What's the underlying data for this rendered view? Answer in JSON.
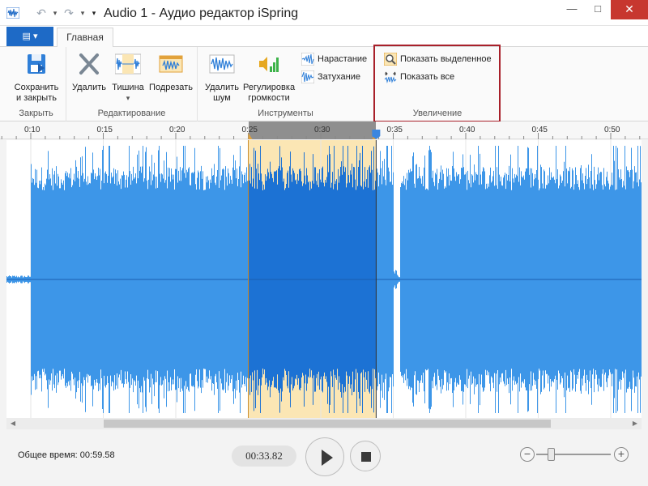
{
  "window": {
    "title": "Audio 1 - Аудио редактор iSpring",
    "minimize": "—",
    "maximize": "□",
    "close": "✕"
  },
  "quick_access": {
    "undo": "↶",
    "redo": "↷",
    "dropdown": "▾"
  },
  "ribbon": {
    "file_button": "▤ ▾",
    "tab_home": "Главная",
    "groups": {
      "close": {
        "label": "Закрыть",
        "save_close_line1": "Сохранить",
        "save_close_line2": "и закрыть"
      },
      "edit": {
        "label": "Редактирование",
        "delete": "Удалить",
        "silence": "Тишина",
        "silence_arrow": "▾",
        "trim": "Подрезать"
      },
      "tools": {
        "label": "Инструменты",
        "noise_line1": "Удалить",
        "noise_line2": "шум",
        "volume_line1": "Регулировка",
        "volume_line2": "громкости",
        "fade_in": "Нарастание",
        "fade_out": "Затухание"
      },
      "zoom": {
        "label": "Увеличение",
        "show_selection": "Показать выделенное",
        "show_all": "Показать все"
      }
    }
  },
  "timeline": {
    "ticks": [
      {
        "label": "0:10",
        "seconds": 10
      },
      {
        "label": "0:15",
        "seconds": 15
      },
      {
        "label": "0:20",
        "seconds": 20
      },
      {
        "label": "0:25",
        "seconds": 25
      },
      {
        "label": "0:30",
        "seconds": 30
      },
      {
        "label": "0:35",
        "seconds": 35
      },
      {
        "label": "0:40",
        "seconds": 40
      },
      {
        "label": "0:45",
        "seconds": 45
      },
      {
        "label": "0:50",
        "seconds": 50
      }
    ],
    "selection_start_seconds": 25,
    "selection_end_seconds": 33.82
  },
  "colors": {
    "waveform": "#3d96e8",
    "waveform_selected": "#1c72d4",
    "selection_bg": "#fbe6b4",
    "accent": "#1e6ac6",
    "highlight_border": "#a8202a"
  },
  "status": {
    "total_time_label": "Общее время:",
    "total_time_value": "00:59.58",
    "current_time": "00:33.82"
  },
  "zoom_level": 0.2
}
